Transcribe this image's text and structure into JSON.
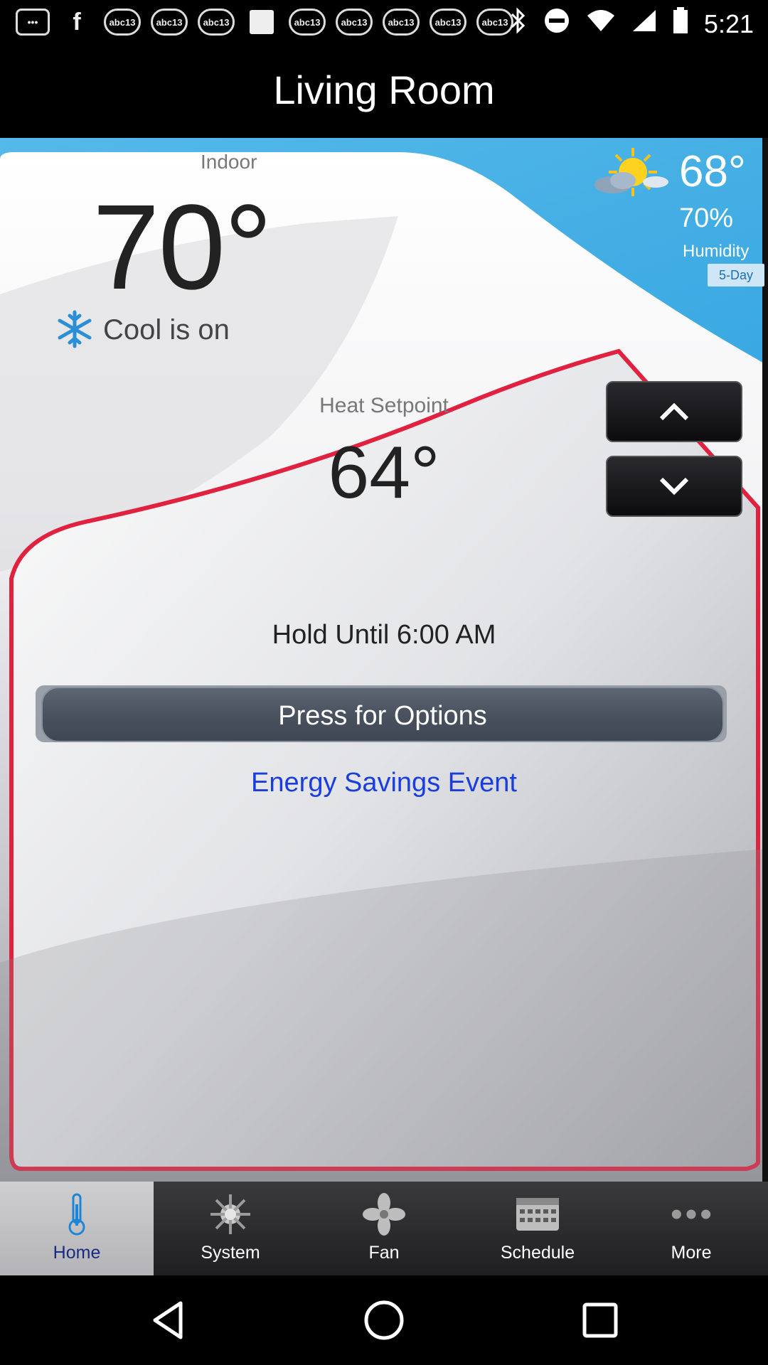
{
  "status_bar": {
    "time": "5:21",
    "left_icons": [
      "more-dots-icon",
      "facebook-icon",
      "abc13-icon",
      "abc13-icon",
      "abc13-icon",
      "blank-square-icon",
      "abc13-icon",
      "abc13-icon",
      "abc13-icon",
      "abc13-icon",
      "abc13-icon"
    ],
    "abc_text": "abc13"
  },
  "header": {
    "title": "Living Room"
  },
  "indoor": {
    "label": "Indoor",
    "temperature": "70°"
  },
  "mode": {
    "text": "Cool is on"
  },
  "outdoor": {
    "temperature": "68°",
    "humidity_value": "70%",
    "humidity_label": "Humidity",
    "forecast_button": "5-Day"
  },
  "setpoint": {
    "label": "Heat Setpoint",
    "value": "64°"
  },
  "hold": {
    "text": "Hold Until 6:00 AM"
  },
  "options": {
    "label": "Press for Options"
  },
  "event": {
    "text": "Energy Savings Event"
  },
  "nav": {
    "items": [
      {
        "label": "Home",
        "icon": "thermometer-icon",
        "active": true
      },
      {
        "label": "System",
        "icon": "system-icon",
        "active": false
      },
      {
        "label": "Fan",
        "icon": "fan-icon",
        "active": false
      },
      {
        "label": "Schedule",
        "icon": "schedule-icon",
        "active": false
      },
      {
        "label": "More",
        "icon": "more-icon",
        "active": false
      }
    ]
  },
  "colors": {
    "accent_blue": "#2a9ede",
    "alert_red": "#e0213f",
    "link_blue": "#1a3de0"
  }
}
